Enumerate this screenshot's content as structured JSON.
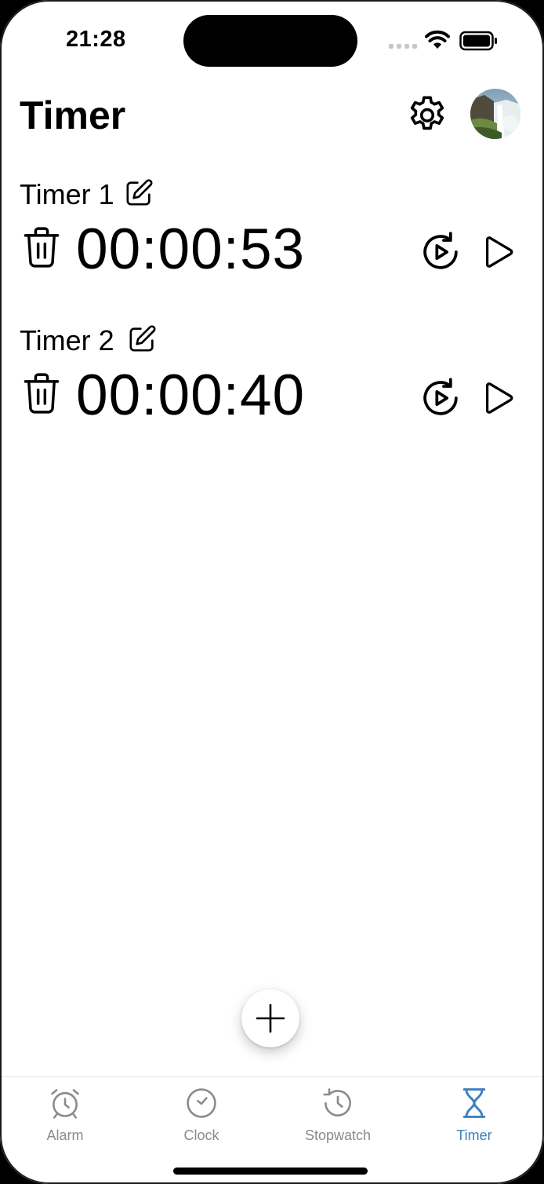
{
  "status_bar": {
    "time": "21:28"
  },
  "header": {
    "title": "Timer"
  },
  "icons": {
    "settings": "gear-icon",
    "avatar": "waterfall-photo",
    "edit": "pencil-square-icon",
    "delete": "trash-icon",
    "restart": "restart-play-icon",
    "play": "play-icon",
    "add": "plus-icon"
  },
  "timers": [
    {
      "name": "Timer 1",
      "value": "00:00:53"
    },
    {
      "name": "Timer 2",
      "value": "00:00:40"
    }
  ],
  "tabs": [
    {
      "label": "Alarm",
      "icon": "alarm-clock-icon",
      "active": false
    },
    {
      "label": "Clock",
      "icon": "clock-icon",
      "active": false
    },
    {
      "label": "Stopwatch",
      "icon": "history-clock-icon",
      "active": false
    },
    {
      "label": "Timer",
      "icon": "hourglass-icon",
      "active": true
    }
  ],
  "colors": {
    "accent": "#3f7fbf",
    "inactive": "#8a8a8a",
    "text": "#000000"
  }
}
